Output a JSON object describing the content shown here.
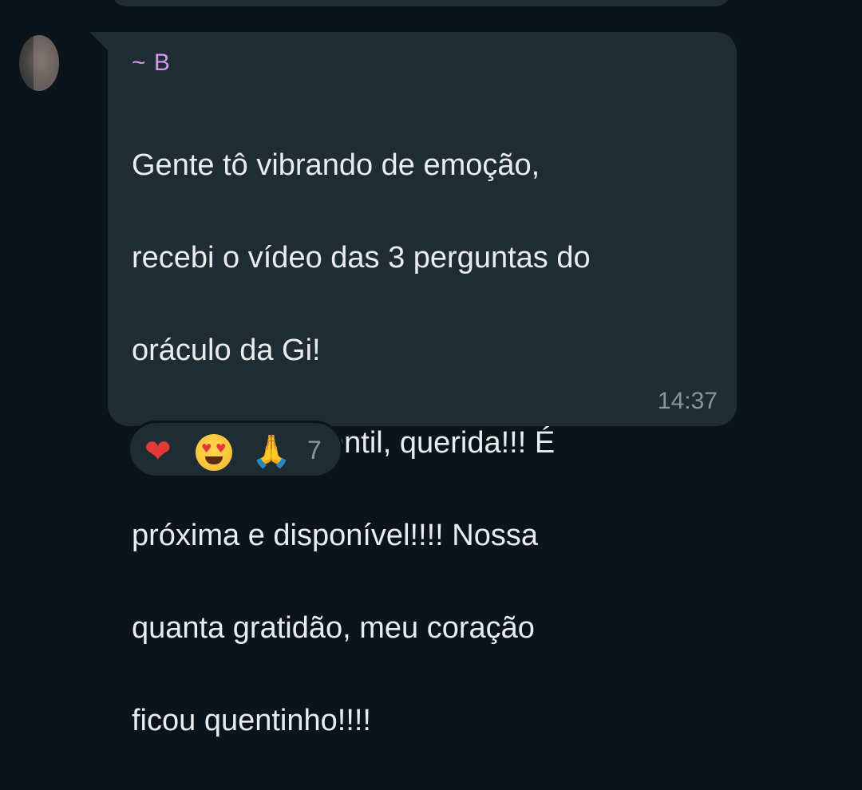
{
  "message": {
    "sender": "~ B",
    "text_lines": [
      "Gente tô vibrando de emoção,",
      "recebi o vídeo das 3 perguntas do",
      "oráculo da Gi!",
      "Como a Gi é gentil, querida!!! É",
      "próxima e disponível!!!! Nossa",
      "quanta gratidão, meu coração",
      "ficou quentinho!!!!"
    ],
    "time": "14:37"
  },
  "reactions": {
    "items": [
      {
        "icon": "heart-icon",
        "glyph": "❤"
      },
      {
        "icon": "heart-eyes-face-icon"
      },
      {
        "icon": "folded-hands-icon",
        "glyph": "🙏"
      }
    ],
    "count": "7"
  },
  "colors": {
    "background": "#0b141a",
    "bubble": "#1f2c33",
    "sender": "#d49ae8",
    "text": "#e9edef",
    "meta": "#8696a0"
  }
}
